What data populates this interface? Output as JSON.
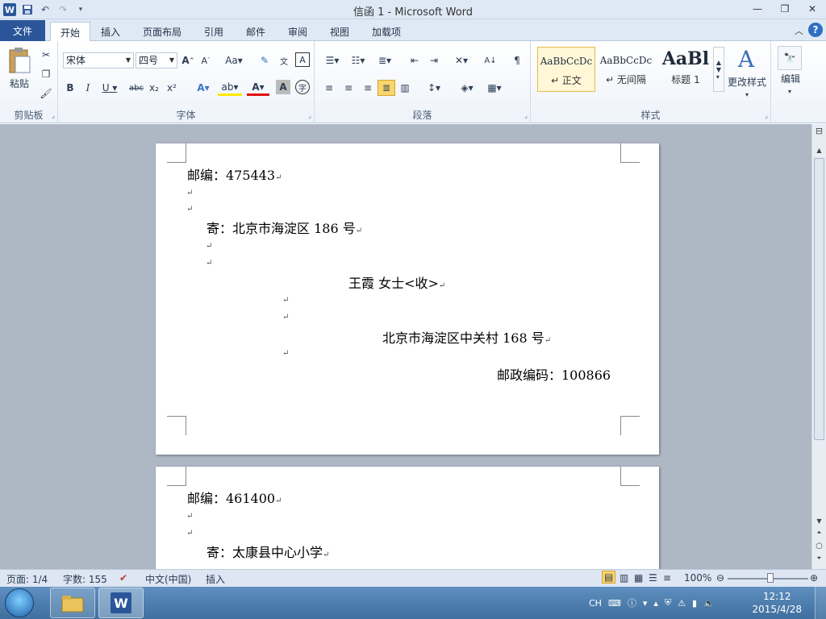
{
  "window": {
    "title": "信函 1  -  Microsoft Word"
  },
  "qat": {
    "app_icon": "word-icon",
    "save_icon": "save-icon",
    "undo_icon": "undo-icon",
    "redo_icon": "redo-icon",
    "customize_icon": "customize-qat-icon"
  },
  "tabs": [
    {
      "label": "文件"
    },
    {
      "label": "开始"
    },
    {
      "label": "插入"
    },
    {
      "label": "页面布局"
    },
    {
      "label": "引用"
    },
    {
      "label": "邮件"
    },
    {
      "label": "审阅"
    },
    {
      "label": "视图"
    },
    {
      "label": "加载项"
    }
  ],
  "ribbon": {
    "clipboard": {
      "label": "剪贴板",
      "paste": "粘贴"
    },
    "font": {
      "label": "字体",
      "font_name": "宋体",
      "font_size": "四号"
    },
    "paragraph": {
      "label": "段落"
    },
    "styles": {
      "label": "样式",
      "items": [
        {
          "sample": "AaBbCcDc",
          "name": "↵ 正文"
        },
        {
          "sample": "AaBbCcDc",
          "name": "↵ 无间隔"
        },
        {
          "sample": "AaBl",
          "name": "标题 1"
        }
      ],
      "change_styles": "更改样式"
    },
    "editing": {
      "label": "编辑"
    }
  },
  "pages": [
    {
      "lines": [
        {
          "text": "邮编：475443"
        },
        {
          "text": "寄：北京市海淀区 186 号"
        },
        {
          "text": "王霞    女士<收>"
        },
        {
          "text": "北京市海淀区中关村 168 号"
        },
        {
          "text": "邮政编码：100866"
        }
      ]
    },
    {
      "lines": [
        {
          "text": "邮编：461400"
        },
        {
          "text": "寄：太康县中心小学"
        }
      ]
    }
  ],
  "paragraph_mark": "↵",
  "statusbar": {
    "page": "页面: 1/4",
    "words": "字数: 155",
    "language": "中文(中国)",
    "mode": "插入",
    "zoom": "100%",
    "zoom_level": 1.0
  },
  "taskbar": {
    "ime": "CH",
    "time": "12:12",
    "date": "2015/4/28"
  },
  "colors": {
    "file_tab": "#2a5699",
    "ribbon_bg": "#dfe9f5",
    "doc_bg": "#aeb7c4",
    "taskbar": "#4a7aaa"
  }
}
